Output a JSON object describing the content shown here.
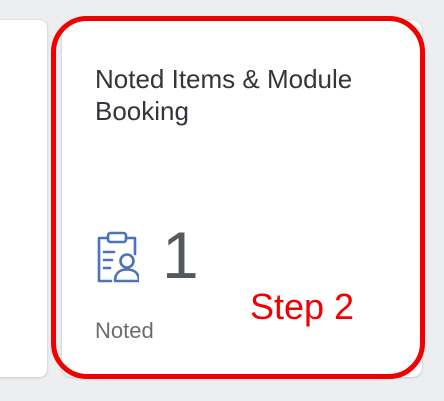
{
  "tile": {
    "title": "Noted Items & Module Booking",
    "kpi_value": "1",
    "kpi_icon": "clipboard-user-icon",
    "footer": "Noted"
  },
  "annotation": {
    "label": "Step 2",
    "color": "#f00000"
  },
  "colors": {
    "icon": "#4a73b8",
    "background": "#eceef0"
  }
}
